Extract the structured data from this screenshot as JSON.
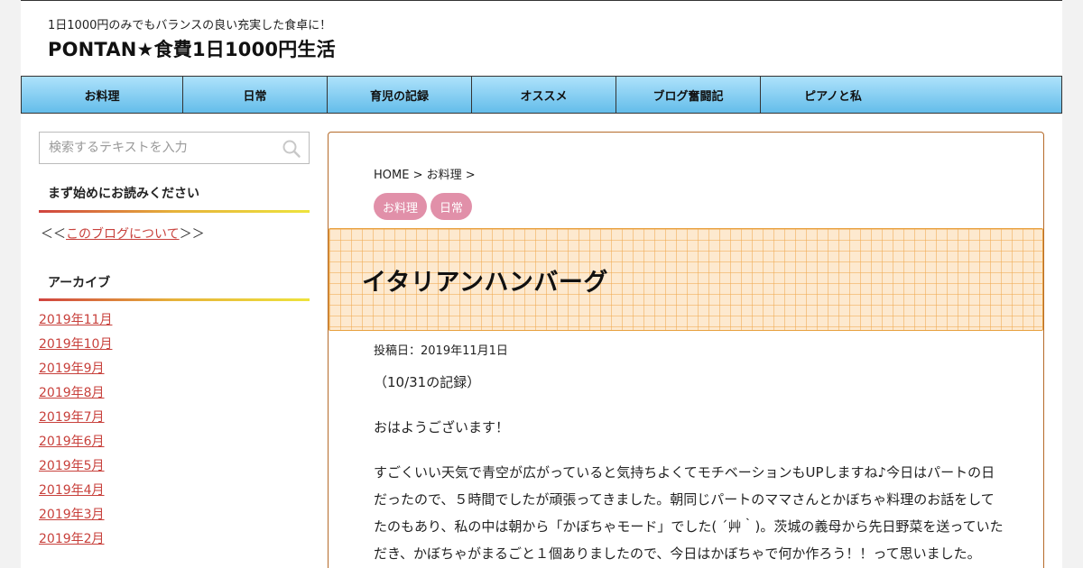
{
  "header": {
    "tagline": "1日1000円のみでもバランスの良い充実した食卓に！",
    "site_title": "PONTAN★食費1日1000円生活"
  },
  "nav": {
    "items": [
      {
        "label": "お料理"
      },
      {
        "label": "日常"
      },
      {
        "label": "育児の記録"
      },
      {
        "label": "オススメ"
      },
      {
        "label": "ブログ奮闘記"
      },
      {
        "label": "ピアノと私"
      }
    ]
  },
  "sidebar": {
    "search_placeholder": "検索するテキストを入力",
    "search_icon": "search-icon",
    "widget1_title": "まず始めにお読みください",
    "about_prefix": "＜＜",
    "about_link": "このブログについて",
    "about_suffix": "＞＞",
    "widget2_title": "アーカイブ",
    "archives": [
      "2019年11月",
      "2019年10月",
      "2019年9月",
      "2019年8月",
      "2019年7月",
      "2019年6月",
      "2019年5月",
      "2019年4月",
      "2019年3月",
      "2019年2月"
    ]
  },
  "article": {
    "breadcrumb_home": "HOME",
    "breadcrumb_sep1": " > ",
    "breadcrumb_cat": "お料理",
    "breadcrumb_sep2": " >",
    "categories": [
      "お料理",
      "日常"
    ],
    "title": "イタリアンハンバーグ",
    "post_date": "投稿日：2019年11月1日",
    "paragraphs": [
      "（10/31の記録）",
      "おはようございます！",
      "すごくいい天気で青空が広がっていると気持ちよくてモチベーションもUPしますね♪今日はパートの日だったので、５時間でしたが頑張ってきました。朝同じパートのママさんとかぼちゃ料理のお話をしてたのもあり、私の中は朝から「かぼちゃモード」でした( ´艸｀)。茨城の義母から先日野菜を送っていただき、かぼちゃがまるごと１個ありましたので、今日はかぼちゃで何か作ろう！！って思いました。"
    ]
  },
  "colors": {
    "nav_gradient_top": "#aee2fb",
    "nav_gradient_bottom": "#64bdea",
    "link_red": "#c8413c",
    "category_pink": "#e190a9",
    "title_box_bg": "#fde9cf",
    "article_border": "#b56b2a"
  }
}
